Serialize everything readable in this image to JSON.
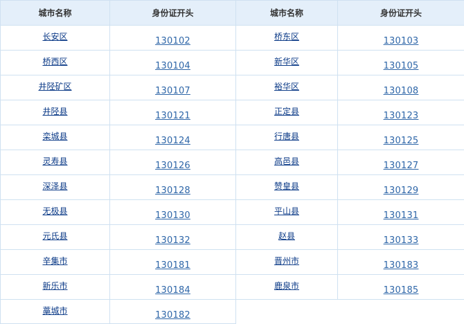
{
  "headers": [
    "城市名称",
    "身份证开头",
    "城市名称",
    "身份证开头"
  ],
  "rows": [
    {
      "c1": "长安区",
      "k1": "130102",
      "c2": "桥东区",
      "k2": "130103"
    },
    {
      "c1": "桥西区",
      "k1": "130104",
      "c2": "新华区",
      "k2": "130105"
    },
    {
      "c1": "井陉矿区",
      "k1": "130107",
      "c2": "裕华区",
      "k2": "130108"
    },
    {
      "c1": "井陉县",
      "k1": "130121",
      "c2": "正定县",
      "k2": "130123"
    },
    {
      "c1": "栾城县",
      "k1": "130124",
      "c2": "行唐县",
      "k2": "130125"
    },
    {
      "c1": "灵寿县",
      "k1": "130126",
      "c2": "高邑县",
      "k2": "130127"
    },
    {
      "c1": "深泽县",
      "k1": "130128",
      "c2": "赞皇县",
      "k2": "130129"
    },
    {
      "c1": "无极县",
      "k1": "130130",
      "c2": "平山县",
      "k2": "130131"
    },
    {
      "c1": "元氏县",
      "k1": "130132",
      "c2": "赵县",
      "k2": "130133"
    },
    {
      "c1": "辛集市",
      "k1": "130181",
      "c2": "晋州市",
      "k2": "130183"
    },
    {
      "c1": "新乐市",
      "k1": "130184",
      "c2": "鹿泉市",
      "k2": "130185"
    },
    {
      "c1": "藁城市",
      "k1": "130182",
      "c2": "",
      "k2": ""
    }
  ],
  "colors": {
    "header_bg": "#e4effa",
    "border": "#cfe1f1",
    "city_link": "#0b3a87",
    "code_link": "#2e66a8"
  }
}
